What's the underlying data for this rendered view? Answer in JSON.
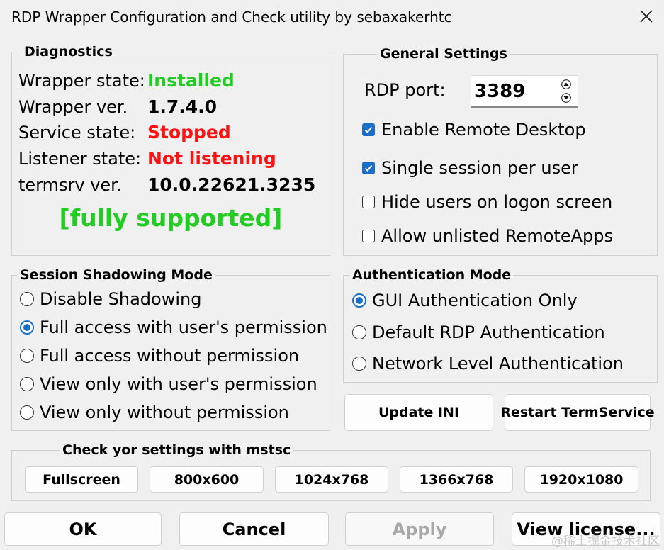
{
  "window": {
    "title": "RDP Wrapper Configuration and Check utility by sebaxakerhtc",
    "close_icon": "close-icon"
  },
  "diagnostics": {
    "title": "Diagnostics",
    "wrapper_state_label": "Wrapper state:",
    "wrapper_state_value": "Installed",
    "wrapper_ver_label": "Wrapper ver.",
    "wrapper_ver_value": "1.7.4.0",
    "service_state_label": "Service state:",
    "service_state_value": "Stopped",
    "listener_state_label": "Listener state:",
    "listener_state_value": "Not listening",
    "termsrv_ver_label": "termsrv ver.",
    "termsrv_ver_value": "10.0.22621.3235",
    "support_status": "[fully supported]",
    "colors": {
      "ok": "#22cc22",
      "bad": "#ff1111"
    }
  },
  "general": {
    "title": "General Settings",
    "rdp_port_label": "RDP port:",
    "rdp_port_value": "3389",
    "checkboxes": [
      {
        "label": "Enable Remote Desktop",
        "checked": true
      },
      {
        "label": "Single session per user",
        "checked": true
      },
      {
        "label": "Hide users on logon screen",
        "checked": false
      },
      {
        "label": "Allow unlisted RemoteApps",
        "checked": false
      }
    ]
  },
  "shadowing": {
    "title": "Session Shadowing Mode",
    "options": [
      {
        "label": "Disable Shadowing",
        "selected": false
      },
      {
        "label": "Full access with user's permission",
        "selected": true
      },
      {
        "label": "Full access without permission",
        "selected": false
      },
      {
        "label": "View only with user's permission",
        "selected": false
      },
      {
        "label": "View only without permission",
        "selected": false
      }
    ]
  },
  "auth": {
    "title": "Authentication Mode",
    "options": [
      {
        "label": "GUI Authentication Only",
        "selected": true
      },
      {
        "label": "Default RDP Authentication",
        "selected": false
      },
      {
        "label": "Network Level Authentication",
        "selected": false
      }
    ]
  },
  "actions": {
    "update_ini": "Update INI",
    "restart_termservice": "Restart TermService"
  },
  "mstsc": {
    "title": "Check yor settings with mstsc",
    "buttons": [
      "Fullscreen",
      "800x600",
      "1024x768",
      "1366x768",
      "1920x1080"
    ]
  },
  "footer": {
    "ok": "OK",
    "cancel": "Cancel",
    "apply": "Apply",
    "view_license": "View license..."
  },
  "watermark": "@稀土掘金技术社区"
}
